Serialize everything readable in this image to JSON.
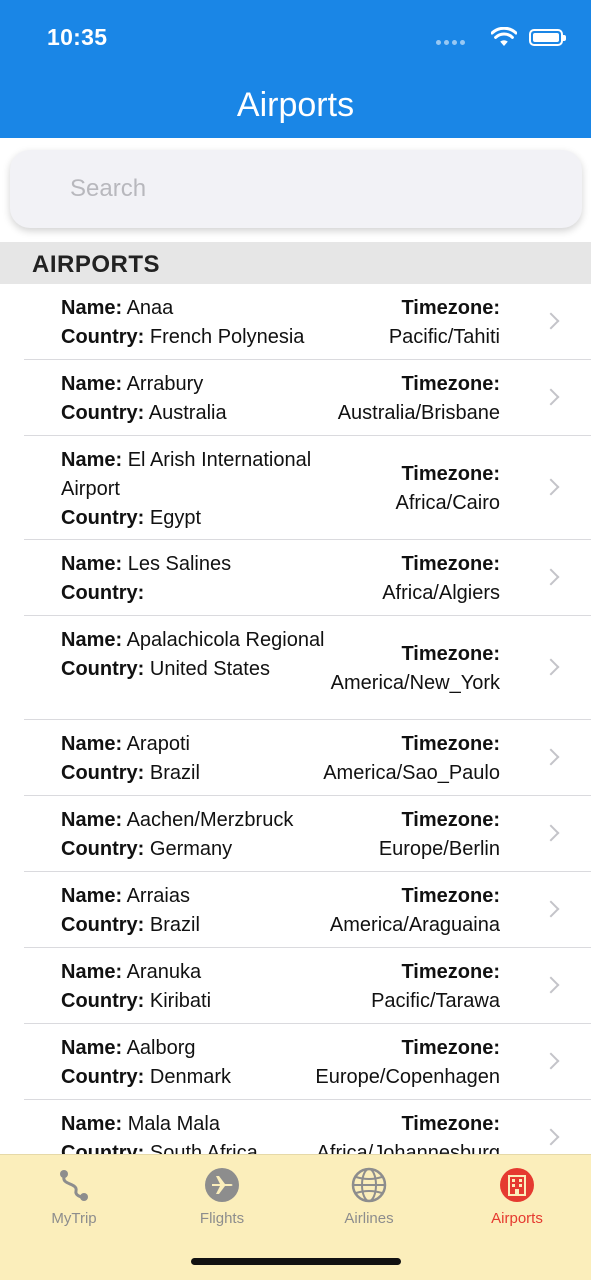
{
  "status": {
    "time": "10:35"
  },
  "nav": {
    "title": "Airports"
  },
  "search": {
    "placeholder": "Search",
    "value": ""
  },
  "section": {
    "title": "AIRPORTS"
  },
  "labels": {
    "name": "Name:",
    "country": "Country:",
    "timezone": "Timezone:"
  },
  "airports": [
    {
      "name": "Anaa",
      "country": "French Polynesia",
      "timezone": "Pacific/Tahiti"
    },
    {
      "name": "Arrabury",
      "country": "Australia",
      "timezone": "Australia/Brisbane"
    },
    {
      "name": "El Arish International Airport",
      "country": "Egypt",
      "timezone": "Africa/Cairo"
    },
    {
      "name": "Les Salines",
      "country": "",
      "timezone": "Africa/Algiers"
    },
    {
      "name": "Apalachicola Regional",
      "country": "United States",
      "timezone": "America/New_York"
    },
    {
      "name": "Arapoti",
      "country": "Brazil",
      "timezone": "America/Sao_Paulo"
    },
    {
      "name": "Aachen/Merzbruck",
      "country": "Germany",
      "timezone": "Europe/Berlin"
    },
    {
      "name": "Arraias",
      "country": "Brazil",
      "timezone": "America/Araguaina"
    },
    {
      "name": "Aranuka",
      "country": "Kiribati",
      "timezone": "Pacific/Tarawa"
    },
    {
      "name": "Aalborg",
      "country": "Denmark",
      "timezone": "Europe/Copenhagen"
    },
    {
      "name": "Mala Mala",
      "country": "South Africa",
      "timezone": "Africa/Johannesburg"
    }
  ],
  "tabs": [
    {
      "label": "MyTrip",
      "icon": "route-icon",
      "active": false
    },
    {
      "label": "Flights",
      "icon": "plane-icon",
      "active": false
    },
    {
      "label": "Airlines",
      "icon": "globe-icon",
      "active": false
    },
    {
      "label": "Airports",
      "icon": "building-icon",
      "active": true
    }
  ],
  "colors": {
    "nav_background": "#1a86e6",
    "tabbar_background": "#fbeebb",
    "active_tab": "#e53a30",
    "inactive_tab": "#8d8d8d"
  }
}
